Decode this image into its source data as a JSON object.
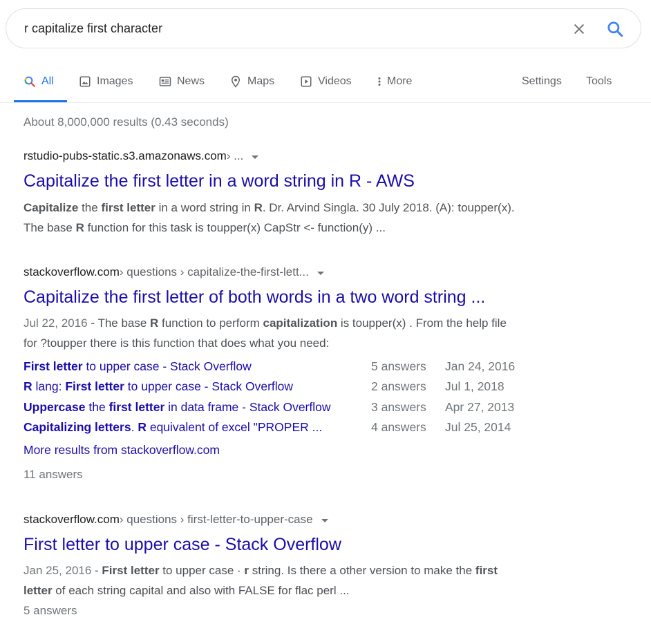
{
  "search": {
    "query": "r capitalize first character"
  },
  "tabs": [
    {
      "label": "All",
      "icon": "search-icon"
    },
    {
      "label": "Images",
      "icon": "image-icon"
    },
    {
      "label": "News",
      "icon": "news-icon"
    },
    {
      "label": "Maps",
      "icon": "map-pin-icon"
    },
    {
      "label": "Videos",
      "icon": "video-icon"
    },
    {
      "label": "More",
      "icon": "more-vert-icon"
    },
    {
      "label": "Settings"
    },
    {
      "label": "Tools"
    }
  ],
  "stats": "About 8,000,000 results (0.43 seconds)",
  "results": [
    {
      "domain": "rstudio-pubs-static.s3.amazonaws.com",
      "path": " › ...",
      "title": "Capitalize the first letter in a word string in R - AWS",
      "snippet_line1": [
        {
          "t": "Capitalize",
          "b": true
        },
        {
          "t": " the ",
          "b": false
        },
        {
          "t": "first letter",
          "b": true
        },
        {
          "t": " in a word string in ",
          "b": false
        },
        {
          "t": "R",
          "b": true
        },
        {
          "t": ". Dr. Arvind Singla. 30 July 2018. (A): toupper(x).",
          "b": false
        }
      ],
      "snippet_line2": [
        {
          "t": "The base ",
          "b": false
        },
        {
          "t": "R",
          "b": true
        },
        {
          "t": " function for this task is toupper(x) CapStr <- function(y) ...",
          "b": false
        }
      ]
    },
    {
      "domain": "stackoverflow.com",
      "path": " › questions › capitalize-the-first-lett...",
      "title": "Capitalize the first letter of both words in a two word string ...",
      "date": "Jul 22, 2016",
      "snippet_line1": [
        {
          "t": " - The base ",
          "b": false
        },
        {
          "t": "R",
          "b": true
        },
        {
          "t": " function to perform ",
          "b": false
        },
        {
          "t": "capitalization",
          "b": true
        },
        {
          "t": " is toupper(x) . From the help file",
          "b": false
        }
      ],
      "snippet_line2": [
        {
          "t": "for ?toupper there is this function that does what you need:",
          "b": false
        }
      ],
      "subresults": [
        {
          "parts": [
            {
              "t": "First letter",
              "b": true
            },
            {
              "t": " to upper case - Stack Overflow",
              "b": false
            }
          ],
          "count": "5 answers",
          "date": "Jan 24, 2016"
        },
        {
          "parts": [
            {
              "t": "R",
              "b": true
            },
            {
              "t": " lang: ",
              "b": false
            },
            {
              "t": "First letter",
              "b": true
            },
            {
              "t": " to upper case - Stack Overflow",
              "b": false
            }
          ],
          "count": "2 answers",
          "date": "Jul 1, 2018"
        },
        {
          "parts": [
            {
              "t": "Uppercase",
              "b": true
            },
            {
              "t": " the ",
              "b": false
            },
            {
              "t": "first letter",
              "b": true
            },
            {
              "t": " in data frame - Stack Overflow",
              "b": false
            }
          ],
          "count": "3 answers",
          "date": "Apr 27, 2013"
        },
        {
          "parts": [
            {
              "t": "Capitalizing letters",
              "b": true
            },
            {
              "t": ". ",
              "b": false
            },
            {
              "t": "R",
              "b": true
            },
            {
              "t": " equivalent of excel \"PROPER ...",
              "b": false
            }
          ],
          "count": "4 answers",
          "date": "Jul 25, 2014"
        }
      ],
      "more_link": "More results from stackoverflow.com",
      "answers": "11 answers"
    },
    {
      "domain": "stackoverflow.com",
      "path": " › questions › first-letter-to-upper-case",
      "title": "First letter to upper case - Stack Overflow",
      "date": "Jan 25, 2016",
      "snippet_line1": [
        {
          "t": " - ",
          "b": false
        },
        {
          "t": "First letter",
          "b": true
        },
        {
          "t": " to upper case · ",
          "b": false
        },
        {
          "t": "r",
          "b": true
        },
        {
          "t": " string. Is there a other version to make the ",
          "b": false
        },
        {
          "t": "first",
          "b": true
        }
      ],
      "snippet_line2": [
        {
          "t": "letter",
          "b": true
        },
        {
          "t": " of each string capital and also with FALSE for flac perl ...",
          "b": false
        }
      ],
      "answers": "5 answers"
    }
  ]
}
